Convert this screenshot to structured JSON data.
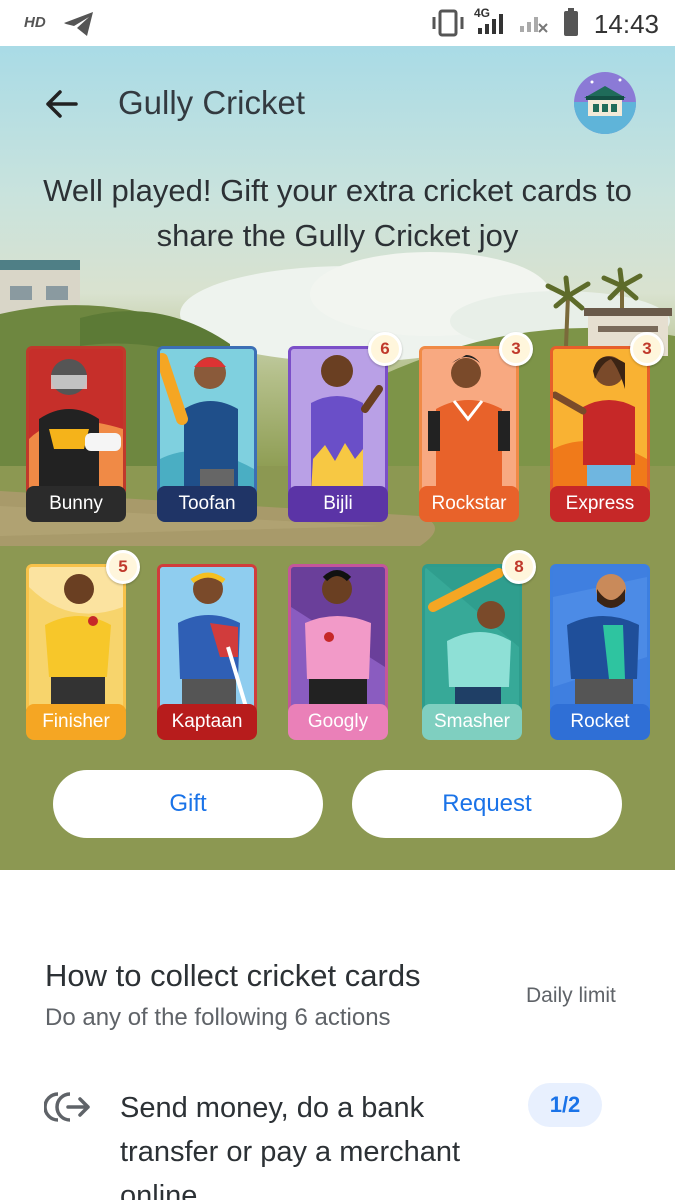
{
  "status_bar": {
    "hd_label": "HD",
    "network_label": "4G",
    "time": "14:43",
    "icons": [
      "telegram-icon",
      "vibrate-icon",
      "signal-icon",
      "no-signal-icon",
      "battery-icon"
    ]
  },
  "header": {
    "title": "Gully Cricket",
    "back_icon": "arrow-left-icon",
    "avatar_icon": "house-avatar-icon"
  },
  "headline": "Well played! Gift your extra cricket cards to share the Gully Cricket joy",
  "cards": [
    {
      "name": "Bunny",
      "count": "",
      "label_color": "#2b2b2b",
      "frame_color": "#c0392b"
    },
    {
      "name": "Toofan",
      "count": "",
      "label_color": "#1f3466",
      "frame_color": "#3c6fb5"
    },
    {
      "name": "Bijli",
      "count": "6",
      "label_color": "#5b34a6",
      "frame_color": "#7b4fc8"
    },
    {
      "name": "Rockstar",
      "count": "3",
      "label_color": "#e8622a",
      "frame_color": "#f08a46"
    },
    {
      "name": "Express",
      "count": "3",
      "label_color": "#c62828",
      "frame_color": "#e65f2b"
    },
    {
      "name": "Finisher",
      "count": "5",
      "label_color": "#f5a623",
      "frame_color": "#f7c24a"
    },
    {
      "name": "Kaptaan",
      "count": "",
      "label_color": "#b71c1c",
      "frame_color": "#d13c3c"
    },
    {
      "name": "Googly",
      "count": "",
      "label_color": "#ea80b8",
      "frame_color": "#c4569a"
    },
    {
      "name": "Smasher",
      "count": "8",
      "label_color": "#7fcfc0",
      "frame_color": "#2e9c8c"
    },
    {
      "name": "Rocket",
      "count": "",
      "label_color": "#2f6fd6",
      "frame_color": "#3d7fe0"
    }
  ],
  "buttons": {
    "gift_label": "Gift",
    "request_label": "Request"
  },
  "how_to": {
    "title": "How to collect cricket cards",
    "subtitle": "Do any of the following 6 actions",
    "daily_limit_label": "Daily limit",
    "actions": [
      {
        "text": "Send money, do a bank transfer or pay a merchant online",
        "limit": "1/2",
        "icon": "send-money-icon"
      }
    ]
  },
  "colors": {
    "accent": "#1a73e8",
    "badge_text": "#c0392b"
  }
}
